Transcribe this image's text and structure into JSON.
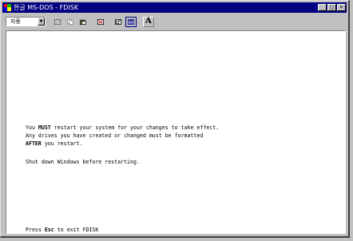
{
  "window": {
    "title": "한글 MS-DOS - FDISK",
    "controls": {
      "minimize": "_",
      "maximize": "□",
      "close": "×"
    }
  },
  "toolbar": {
    "font_select_value": "자동",
    "tools": [
      "mark-icon",
      "copy-icon",
      "paste-icon",
      "fullscreen-icon",
      "properties-icon",
      "background-icon",
      "font-icon"
    ],
    "font_button_label": "A"
  },
  "terminal": {
    "line1_pre": "You ",
    "line1_bold": "MUST",
    "line1_post": " restart your system for your changes to take effect.",
    "line2": "Any drives you have created or changed must be formatted",
    "line3_bold": "AFTER",
    "line3_post": " you restart.",
    "line4": "Shut down Windows before restarting.",
    "footer_pre": "Press ",
    "footer_bold": "Esc",
    "footer_post": " to exit FDISK"
  }
}
